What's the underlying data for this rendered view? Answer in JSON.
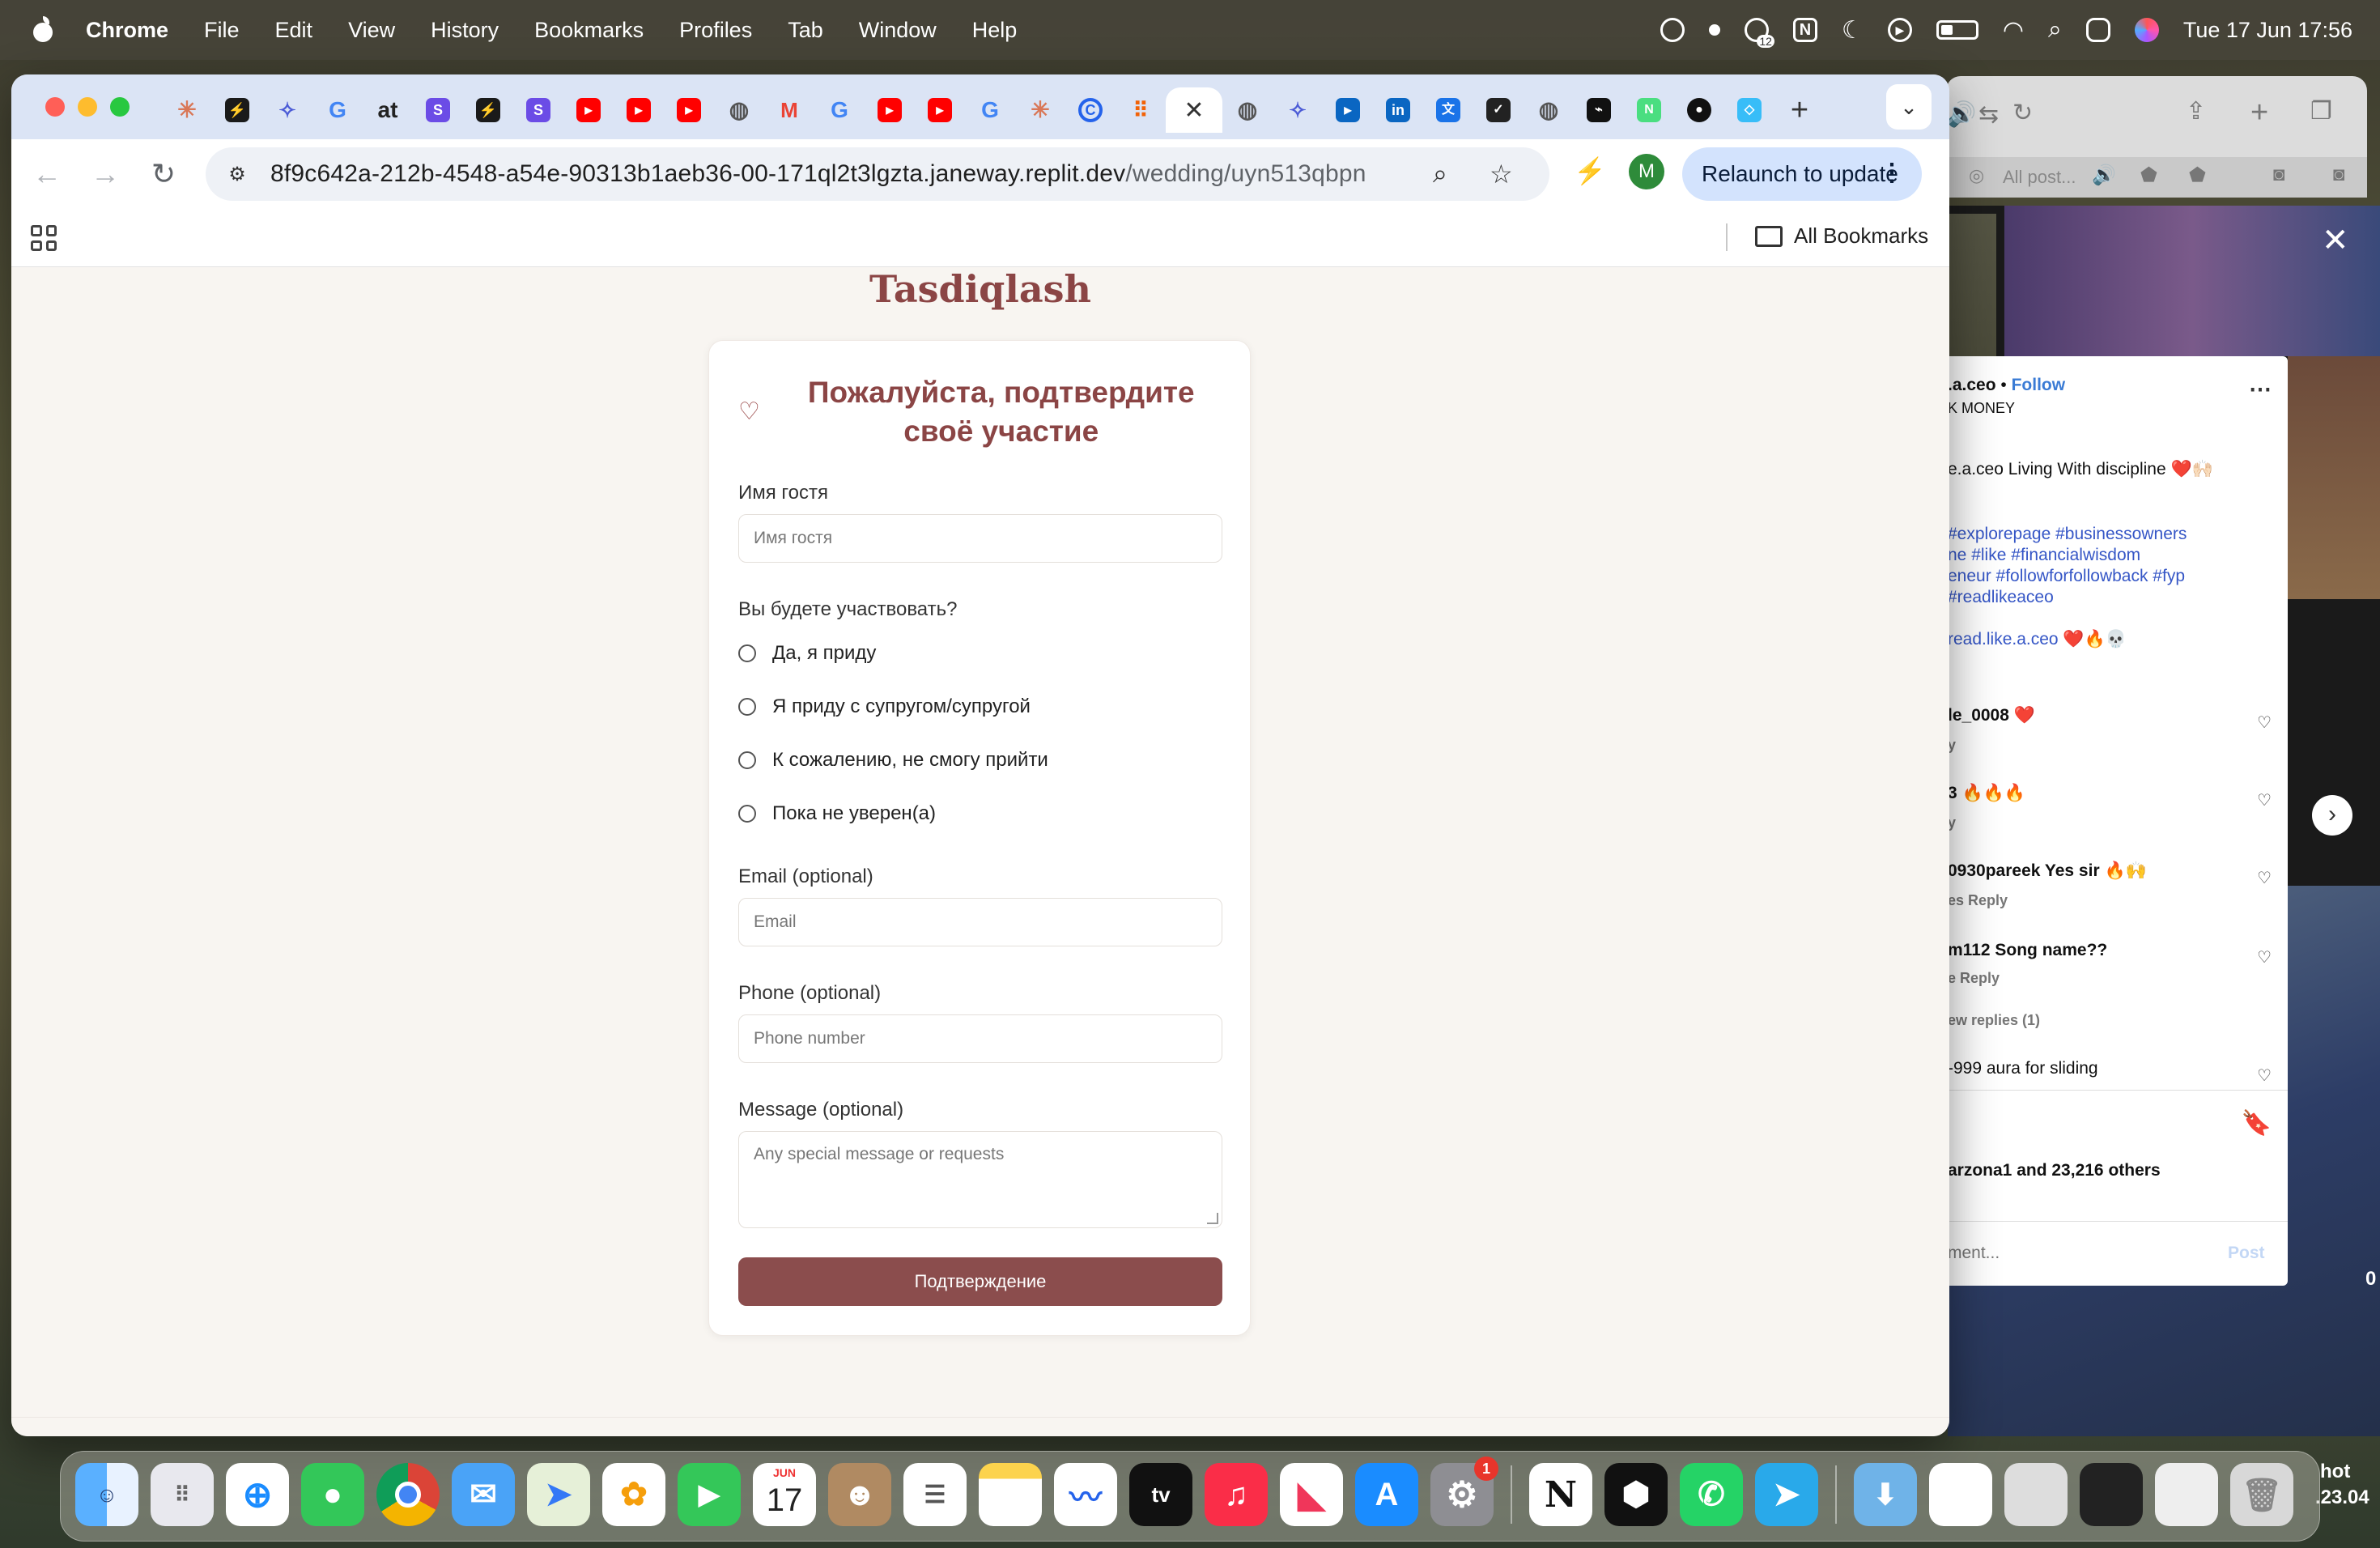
{
  "menubar": {
    "app_name": "Chrome",
    "items": [
      "File",
      "Edit",
      "View",
      "History",
      "Bookmarks",
      "Profiles",
      "Tab",
      "Window",
      "Help"
    ],
    "datetime": "Tue 17 Jun  17:56",
    "badge_count": "12",
    "notion_label": "N"
  },
  "browser": {
    "url_host": "8f9c642a-212b-4548-a54e-90313b1aeb36-00-171ql2t3lgzta.janeway.replit.dev",
    "url_path": "/wedding/uyn513qbpn",
    "relaunch_label": "Relaunch to update",
    "avatar_letter": "M",
    "all_bookmarks_label": "All Bookmarks",
    "tab_count": 34
  },
  "page": {
    "title": "Tasdiqlash",
    "card_heading": "Пожалуйста, подтвердите своё участие",
    "guest_name_label": "Имя гостя",
    "guest_name_placeholder": "Имя гостя",
    "attend_question": "Вы будете участвовать?",
    "options": [
      "Да, я приду",
      "Я приду с супругом/супругой",
      "К сожалению, не смогу прийти",
      "Пока не уверен(а)"
    ],
    "email_label": "Email (optional)",
    "email_placeholder": "Email",
    "phone_label": "Phone (optional)",
    "phone_placeholder": "Phone number",
    "message_label": "Message (optional)",
    "message_placeholder": "Any special message or requests",
    "submit_label": "Подтверждение"
  },
  "instagram": {
    "username": ".a.ceo",
    "follow": "Follow",
    "sub": "K MONEY",
    "caption": "e.a.ceo Living With discipline ❤️🙌🏻",
    "tags1": " #explorepage #businessowners",
    "tags2": "ne #like #financialwisdom",
    "tags3": "eneur #followforfollowback #fyp",
    "tags4": " #readlikeaceo",
    "mention": "read.like.a.ceo",
    "mention_emoji": " ❤️🔥💀",
    "comments": [
      {
        "text": "le_0008 ❤️",
        "meta": "y"
      },
      {
        "text": "3 🔥🔥🔥",
        "meta": "y"
      },
      {
        "text": "0930pareek Yes sir 🔥🙌",
        "meta": "es   Reply"
      },
      {
        "text": "m112 Song name??",
        "meta": "e    Reply"
      }
    ],
    "view_replies": "ew replies (1)",
    "last_comment": "-999 aura for sliding",
    "likes_name": "arzona1",
    "likes_rest": " and 23,216 others",
    "add_comment": "ment...",
    "post": "Post",
    "safari_tab": "All post..."
  },
  "sidebar_fragments": {
    "right_text_1": "hot",
    "right_text_2": ".23.04",
    "zero": "0"
  },
  "dock": {
    "calendar_month": "JUN",
    "calendar_day": "17",
    "settings_badge": "1",
    "tv_label": "tv"
  }
}
